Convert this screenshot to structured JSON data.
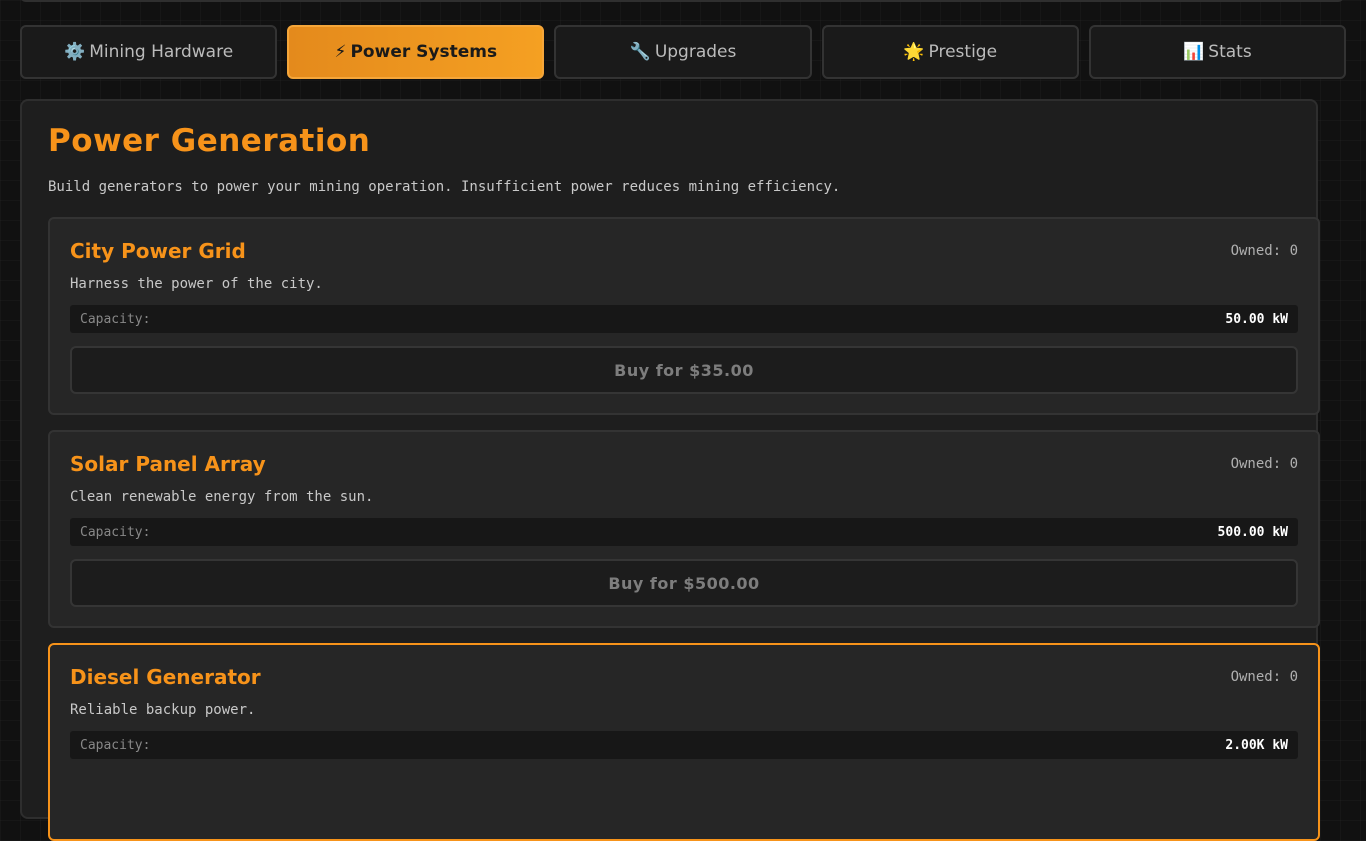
{
  "tabs": [
    {
      "icon": "⚙️",
      "label": "Mining Hardware"
    },
    {
      "icon": "⚡",
      "label": "Power Systems"
    },
    {
      "icon": "🔧",
      "label": "Upgrades"
    },
    {
      "icon": "🌟",
      "label": "Prestige"
    },
    {
      "icon": "📊",
      "label": "Stats"
    }
  ],
  "panel": {
    "title": "Power Generation",
    "description": "Build generators to power your mining operation. Insufficient power reduces mining efficiency."
  },
  "generators": [
    {
      "name": "City Power Grid",
      "owned": "Owned: 0",
      "description": "Harness the power of the city.",
      "stat_label": "Capacity:",
      "stat_value": "50.00 kW",
      "buy_label": "Buy for $35.00"
    },
    {
      "name": "Solar Panel Array",
      "owned": "Owned: 0",
      "description": "Clean renewable energy from the sun.",
      "stat_label": "Capacity:",
      "stat_value": "500.00 kW",
      "buy_label": "Buy for $500.00"
    },
    {
      "name": "Diesel Generator",
      "owned": "Owned: 0",
      "description": "Reliable backup power.",
      "stat_label": "Capacity:",
      "stat_value": "2.00K kW"
    }
  ],
  "colors": {
    "accent": "#f7931a",
    "background": "#111111",
    "panel": "#1e1e1e",
    "card": "#262626"
  }
}
